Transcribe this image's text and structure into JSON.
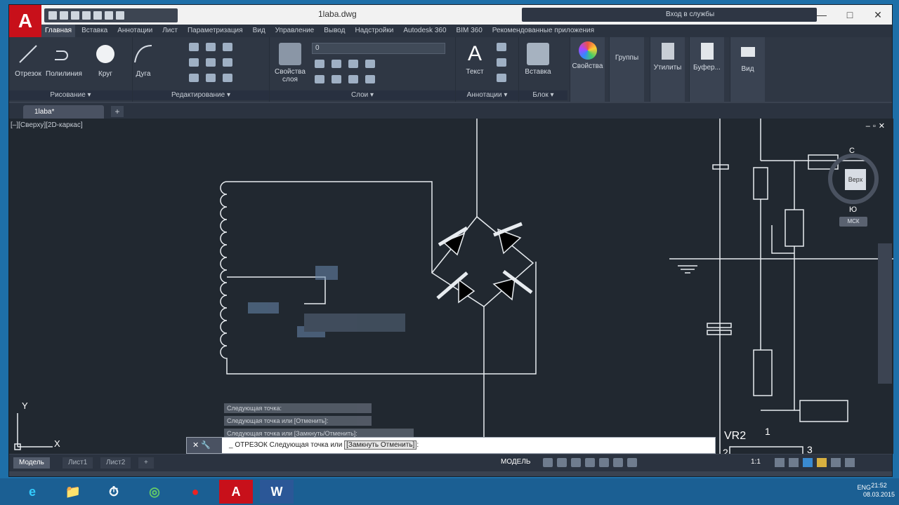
{
  "app": {
    "logo": "A",
    "title": "1laba.dwg",
    "search_placeholder": "Вход в службы",
    "min": "—",
    "max": "□",
    "close": "✕"
  },
  "ribbon_tabs": [
    "Главная",
    "Вставка",
    "Аннотации",
    "Лист",
    "Параметризация",
    "Вид",
    "Управление",
    "Вывод",
    "Надстройки",
    "Autodesk 360",
    "BIM 360",
    "Рекомендованные приложения"
  ],
  "draw_panel": {
    "tools": [
      "Отрезок",
      "Полилиния",
      "Круг",
      "Дуга"
    ],
    "caption": "Рисование ▾"
  },
  "modify_panel": {
    "caption": "Редактирование ▾"
  },
  "layers_panel": {
    "layer_props": "Свойства слоя",
    "current_layer": "0",
    "caption": "Слои ▾"
  },
  "annotation_panel": {
    "text_tool": "Текст",
    "caption": "Аннотации ▾"
  },
  "block_panel": {
    "insert_tool": "Вставка",
    "caption": "Блок ▾"
  },
  "right_panels": [
    "Свойства",
    "Группы",
    "Утилиты",
    "Буфер...",
    "Вид"
  ],
  "file_tab": "1laba*",
  "file_tab_add": "+",
  "viewport": {
    "label": "[–][Сверху][2D-каркас]",
    "controls": "–▫✕",
    "viewcube_face": "Верх",
    "viewcube_n": "С",
    "viewcube_s": "Ю",
    "wcs": "МСК"
  },
  "schematic": {
    "vr_label": "VR2",
    "pin1": "1",
    "pin2": "2",
    "pin3": "3",
    "ucs_y": "Y",
    "ucs_x": "X"
  },
  "command_history": [
    "Следующая точка:",
    "Следующая точка или [Отменить]:",
    "Следующая точка или [Замкнуть/Отменить]:"
  ],
  "command_line": {
    "prefix": "✕ 🔧",
    "prompt": "_ ОТРЕЗОК Следующая точка или",
    "options": "[Замкнуть Отменить]",
    "suffix": ":"
  },
  "layout_tabs": [
    "Модель",
    "Лист1",
    "Лист2"
  ],
  "status": {
    "model": "МОДЕЛЬ",
    "scale": "1:1"
  },
  "taskbar": {
    "apps": [
      "e",
      "📁",
      "⏱",
      "◎",
      "●",
      "A",
      "W"
    ],
    "lang": "ENG",
    "time": "21:52",
    "date": "08.03.2015"
  }
}
